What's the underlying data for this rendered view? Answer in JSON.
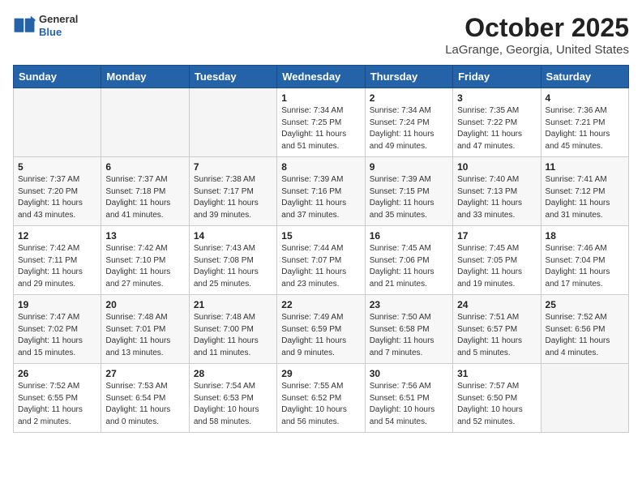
{
  "header": {
    "logo": {
      "general": "General",
      "blue": "Blue"
    },
    "month": "October 2025",
    "location": "LaGrange, Georgia, United States"
  },
  "days_of_week": [
    "Sunday",
    "Monday",
    "Tuesday",
    "Wednesday",
    "Thursday",
    "Friday",
    "Saturday"
  ],
  "weeks": [
    [
      {
        "day": "",
        "info": ""
      },
      {
        "day": "",
        "info": ""
      },
      {
        "day": "",
        "info": ""
      },
      {
        "day": "1",
        "info": "Sunrise: 7:34 AM\nSunset: 7:25 PM\nDaylight: 11 hours\nand 51 minutes."
      },
      {
        "day": "2",
        "info": "Sunrise: 7:34 AM\nSunset: 7:24 PM\nDaylight: 11 hours\nand 49 minutes."
      },
      {
        "day": "3",
        "info": "Sunrise: 7:35 AM\nSunset: 7:22 PM\nDaylight: 11 hours\nand 47 minutes."
      },
      {
        "day": "4",
        "info": "Sunrise: 7:36 AM\nSunset: 7:21 PM\nDaylight: 11 hours\nand 45 minutes."
      }
    ],
    [
      {
        "day": "5",
        "info": "Sunrise: 7:37 AM\nSunset: 7:20 PM\nDaylight: 11 hours\nand 43 minutes."
      },
      {
        "day": "6",
        "info": "Sunrise: 7:37 AM\nSunset: 7:18 PM\nDaylight: 11 hours\nand 41 minutes."
      },
      {
        "day": "7",
        "info": "Sunrise: 7:38 AM\nSunset: 7:17 PM\nDaylight: 11 hours\nand 39 minutes."
      },
      {
        "day": "8",
        "info": "Sunrise: 7:39 AM\nSunset: 7:16 PM\nDaylight: 11 hours\nand 37 minutes."
      },
      {
        "day": "9",
        "info": "Sunrise: 7:39 AM\nSunset: 7:15 PM\nDaylight: 11 hours\nand 35 minutes."
      },
      {
        "day": "10",
        "info": "Sunrise: 7:40 AM\nSunset: 7:13 PM\nDaylight: 11 hours\nand 33 minutes."
      },
      {
        "day": "11",
        "info": "Sunrise: 7:41 AM\nSunset: 7:12 PM\nDaylight: 11 hours\nand 31 minutes."
      }
    ],
    [
      {
        "day": "12",
        "info": "Sunrise: 7:42 AM\nSunset: 7:11 PM\nDaylight: 11 hours\nand 29 minutes."
      },
      {
        "day": "13",
        "info": "Sunrise: 7:42 AM\nSunset: 7:10 PM\nDaylight: 11 hours\nand 27 minutes."
      },
      {
        "day": "14",
        "info": "Sunrise: 7:43 AM\nSunset: 7:08 PM\nDaylight: 11 hours\nand 25 minutes."
      },
      {
        "day": "15",
        "info": "Sunrise: 7:44 AM\nSunset: 7:07 PM\nDaylight: 11 hours\nand 23 minutes."
      },
      {
        "day": "16",
        "info": "Sunrise: 7:45 AM\nSunset: 7:06 PM\nDaylight: 11 hours\nand 21 minutes."
      },
      {
        "day": "17",
        "info": "Sunrise: 7:45 AM\nSunset: 7:05 PM\nDaylight: 11 hours\nand 19 minutes."
      },
      {
        "day": "18",
        "info": "Sunrise: 7:46 AM\nSunset: 7:04 PM\nDaylight: 11 hours\nand 17 minutes."
      }
    ],
    [
      {
        "day": "19",
        "info": "Sunrise: 7:47 AM\nSunset: 7:02 PM\nDaylight: 11 hours\nand 15 minutes."
      },
      {
        "day": "20",
        "info": "Sunrise: 7:48 AM\nSunset: 7:01 PM\nDaylight: 11 hours\nand 13 minutes."
      },
      {
        "day": "21",
        "info": "Sunrise: 7:48 AM\nSunset: 7:00 PM\nDaylight: 11 hours\nand 11 minutes."
      },
      {
        "day": "22",
        "info": "Sunrise: 7:49 AM\nSunset: 6:59 PM\nDaylight: 11 hours\nand 9 minutes."
      },
      {
        "day": "23",
        "info": "Sunrise: 7:50 AM\nSunset: 6:58 PM\nDaylight: 11 hours\nand 7 minutes."
      },
      {
        "day": "24",
        "info": "Sunrise: 7:51 AM\nSunset: 6:57 PM\nDaylight: 11 hours\nand 5 minutes."
      },
      {
        "day": "25",
        "info": "Sunrise: 7:52 AM\nSunset: 6:56 PM\nDaylight: 11 hours\nand 4 minutes."
      }
    ],
    [
      {
        "day": "26",
        "info": "Sunrise: 7:52 AM\nSunset: 6:55 PM\nDaylight: 11 hours\nand 2 minutes."
      },
      {
        "day": "27",
        "info": "Sunrise: 7:53 AM\nSunset: 6:54 PM\nDaylight: 11 hours\nand 0 minutes."
      },
      {
        "day": "28",
        "info": "Sunrise: 7:54 AM\nSunset: 6:53 PM\nDaylight: 10 hours\nand 58 minutes."
      },
      {
        "day": "29",
        "info": "Sunrise: 7:55 AM\nSunset: 6:52 PM\nDaylight: 10 hours\nand 56 minutes."
      },
      {
        "day": "30",
        "info": "Sunrise: 7:56 AM\nSunset: 6:51 PM\nDaylight: 10 hours\nand 54 minutes."
      },
      {
        "day": "31",
        "info": "Sunrise: 7:57 AM\nSunset: 6:50 PM\nDaylight: 10 hours\nand 52 minutes."
      },
      {
        "day": "",
        "info": ""
      }
    ]
  ]
}
